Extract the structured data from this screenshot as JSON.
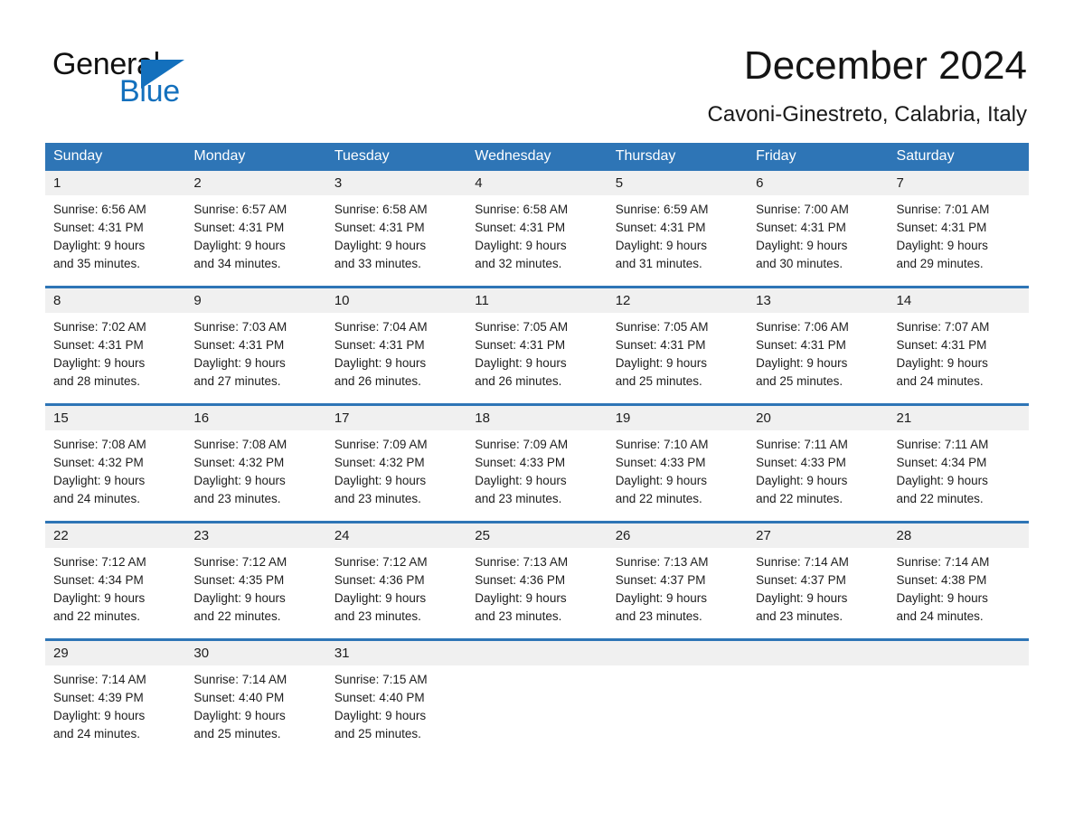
{
  "brand": {
    "name_part1": "General",
    "name_part2": "Blue",
    "triangle_color": "#1370bd",
    "text_color": "#111111",
    "blue_color": "#1370bd"
  },
  "header": {
    "title": "December 2024",
    "location": "Cavoni-Ginestreto, Calabria, Italy"
  },
  "theme": {
    "header_blue": "#2e75b6",
    "band_gray": "#f0f0f0",
    "text_dark": "#1d1d1d"
  },
  "weekday_headers": [
    "Sunday",
    "Monday",
    "Tuesday",
    "Wednesday",
    "Thursday",
    "Friday",
    "Saturday"
  ],
  "weeks": [
    {
      "days": [
        {
          "num": "1",
          "sunrise": "Sunrise: 6:56 AM",
          "sunset": "Sunset: 4:31 PM",
          "daylight1": "Daylight: 9 hours",
          "daylight2": "and 35 minutes."
        },
        {
          "num": "2",
          "sunrise": "Sunrise: 6:57 AM",
          "sunset": "Sunset: 4:31 PM",
          "daylight1": "Daylight: 9 hours",
          "daylight2": "and 34 minutes."
        },
        {
          "num": "3",
          "sunrise": "Sunrise: 6:58 AM",
          "sunset": "Sunset: 4:31 PM",
          "daylight1": "Daylight: 9 hours",
          "daylight2": "and 33 minutes."
        },
        {
          "num": "4",
          "sunrise": "Sunrise: 6:58 AM",
          "sunset": "Sunset: 4:31 PM",
          "daylight1": "Daylight: 9 hours",
          "daylight2": "and 32 minutes."
        },
        {
          "num": "5",
          "sunrise": "Sunrise: 6:59 AM",
          "sunset": "Sunset: 4:31 PM",
          "daylight1": "Daylight: 9 hours",
          "daylight2": "and 31 minutes."
        },
        {
          "num": "6",
          "sunrise": "Sunrise: 7:00 AM",
          "sunset": "Sunset: 4:31 PM",
          "daylight1": "Daylight: 9 hours",
          "daylight2": "and 30 minutes."
        },
        {
          "num": "7",
          "sunrise": "Sunrise: 7:01 AM",
          "sunset": "Sunset: 4:31 PM",
          "daylight1": "Daylight: 9 hours",
          "daylight2": "and 29 minutes."
        }
      ]
    },
    {
      "days": [
        {
          "num": "8",
          "sunrise": "Sunrise: 7:02 AM",
          "sunset": "Sunset: 4:31 PM",
          "daylight1": "Daylight: 9 hours",
          "daylight2": "and 28 minutes."
        },
        {
          "num": "9",
          "sunrise": "Sunrise: 7:03 AM",
          "sunset": "Sunset: 4:31 PM",
          "daylight1": "Daylight: 9 hours",
          "daylight2": "and 27 minutes."
        },
        {
          "num": "10",
          "sunrise": "Sunrise: 7:04 AM",
          "sunset": "Sunset: 4:31 PM",
          "daylight1": "Daylight: 9 hours",
          "daylight2": "and 26 minutes."
        },
        {
          "num": "11",
          "sunrise": "Sunrise: 7:05 AM",
          "sunset": "Sunset: 4:31 PM",
          "daylight1": "Daylight: 9 hours",
          "daylight2": "and 26 minutes."
        },
        {
          "num": "12",
          "sunrise": "Sunrise: 7:05 AM",
          "sunset": "Sunset: 4:31 PM",
          "daylight1": "Daylight: 9 hours",
          "daylight2": "and 25 minutes."
        },
        {
          "num": "13",
          "sunrise": "Sunrise: 7:06 AM",
          "sunset": "Sunset: 4:31 PM",
          "daylight1": "Daylight: 9 hours",
          "daylight2": "and 25 minutes."
        },
        {
          "num": "14",
          "sunrise": "Sunrise: 7:07 AM",
          "sunset": "Sunset: 4:31 PM",
          "daylight1": "Daylight: 9 hours",
          "daylight2": "and 24 minutes."
        }
      ]
    },
    {
      "days": [
        {
          "num": "15",
          "sunrise": "Sunrise: 7:08 AM",
          "sunset": "Sunset: 4:32 PM",
          "daylight1": "Daylight: 9 hours",
          "daylight2": "and 24 minutes."
        },
        {
          "num": "16",
          "sunrise": "Sunrise: 7:08 AM",
          "sunset": "Sunset: 4:32 PM",
          "daylight1": "Daylight: 9 hours",
          "daylight2": "and 23 minutes."
        },
        {
          "num": "17",
          "sunrise": "Sunrise: 7:09 AM",
          "sunset": "Sunset: 4:32 PM",
          "daylight1": "Daylight: 9 hours",
          "daylight2": "and 23 minutes."
        },
        {
          "num": "18",
          "sunrise": "Sunrise: 7:09 AM",
          "sunset": "Sunset: 4:33 PM",
          "daylight1": "Daylight: 9 hours",
          "daylight2": "and 23 minutes."
        },
        {
          "num": "19",
          "sunrise": "Sunrise: 7:10 AM",
          "sunset": "Sunset: 4:33 PM",
          "daylight1": "Daylight: 9 hours",
          "daylight2": "and 22 minutes."
        },
        {
          "num": "20",
          "sunrise": "Sunrise: 7:11 AM",
          "sunset": "Sunset: 4:33 PM",
          "daylight1": "Daylight: 9 hours",
          "daylight2": "and 22 minutes."
        },
        {
          "num": "21",
          "sunrise": "Sunrise: 7:11 AM",
          "sunset": "Sunset: 4:34 PM",
          "daylight1": "Daylight: 9 hours",
          "daylight2": "and 22 minutes."
        }
      ]
    },
    {
      "days": [
        {
          "num": "22",
          "sunrise": "Sunrise: 7:12 AM",
          "sunset": "Sunset: 4:34 PM",
          "daylight1": "Daylight: 9 hours",
          "daylight2": "and 22 minutes."
        },
        {
          "num": "23",
          "sunrise": "Sunrise: 7:12 AM",
          "sunset": "Sunset: 4:35 PM",
          "daylight1": "Daylight: 9 hours",
          "daylight2": "and 22 minutes."
        },
        {
          "num": "24",
          "sunrise": "Sunrise: 7:12 AM",
          "sunset": "Sunset: 4:36 PM",
          "daylight1": "Daylight: 9 hours",
          "daylight2": "and 23 minutes."
        },
        {
          "num": "25",
          "sunrise": "Sunrise: 7:13 AM",
          "sunset": "Sunset: 4:36 PM",
          "daylight1": "Daylight: 9 hours",
          "daylight2": "and 23 minutes."
        },
        {
          "num": "26",
          "sunrise": "Sunrise: 7:13 AM",
          "sunset": "Sunset: 4:37 PM",
          "daylight1": "Daylight: 9 hours",
          "daylight2": "and 23 minutes."
        },
        {
          "num": "27",
          "sunrise": "Sunrise: 7:14 AM",
          "sunset": "Sunset: 4:37 PM",
          "daylight1": "Daylight: 9 hours",
          "daylight2": "and 23 minutes."
        },
        {
          "num": "28",
          "sunrise": "Sunrise: 7:14 AM",
          "sunset": "Sunset: 4:38 PM",
          "daylight1": "Daylight: 9 hours",
          "daylight2": "and 24 minutes."
        }
      ]
    },
    {
      "days": [
        {
          "num": "29",
          "sunrise": "Sunrise: 7:14 AM",
          "sunset": "Sunset: 4:39 PM",
          "daylight1": "Daylight: 9 hours",
          "daylight2": "and 24 minutes."
        },
        {
          "num": "30",
          "sunrise": "Sunrise: 7:14 AM",
          "sunset": "Sunset: 4:40 PM",
          "daylight1": "Daylight: 9 hours",
          "daylight2": "and 25 minutes."
        },
        {
          "num": "31",
          "sunrise": "Sunrise: 7:15 AM",
          "sunset": "Sunset: 4:40 PM",
          "daylight1": "Daylight: 9 hours",
          "daylight2": "and 25 minutes."
        },
        {
          "num": "",
          "sunrise": "",
          "sunset": "",
          "daylight1": "",
          "daylight2": ""
        },
        {
          "num": "",
          "sunrise": "",
          "sunset": "",
          "daylight1": "",
          "daylight2": ""
        },
        {
          "num": "",
          "sunrise": "",
          "sunset": "",
          "daylight1": "",
          "daylight2": ""
        },
        {
          "num": "",
          "sunrise": "",
          "sunset": "",
          "daylight1": "",
          "daylight2": ""
        }
      ]
    }
  ]
}
